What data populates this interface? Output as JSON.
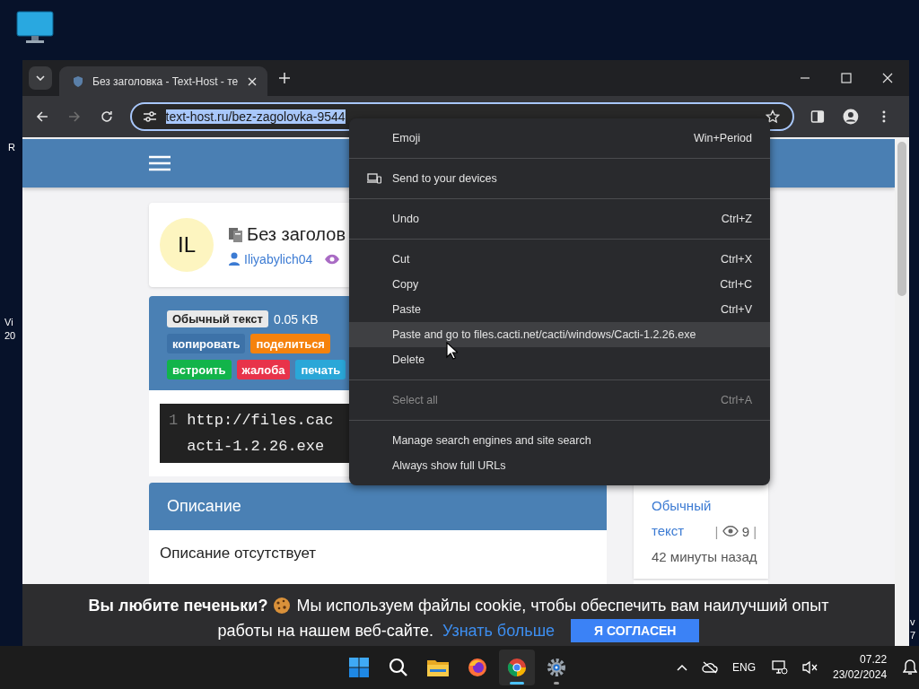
{
  "desktop": {
    "shortcut_labels": [
      {
        "lines": [
          "R"
        ]
      },
      {
        "lines": [
          "Vi",
          "20"
        ]
      },
      {
        "lines": [
          "v",
          "7"
        ]
      }
    ]
  },
  "browser": {
    "tabs": [
      {
        "title": "Без заголовка - Text-Host - те",
        "selected": true
      }
    ],
    "forward_disabled": true,
    "address": {
      "value": "text-host.ru/bez-zagolovka-9544",
      "text_selected": true
    }
  },
  "page": {
    "post": {
      "avatar": "IL",
      "title": "Без заголов",
      "author": "Iliyabylich04"
    },
    "panel": {
      "type_tag": "Обычный текст",
      "size": "0.05 KB",
      "buttons": [
        {
          "label": "копировать",
          "color": "#3d72a8"
        },
        {
          "label": "поделиться",
          "color": "#f5820d"
        },
        {
          "label": "встроить",
          "color": "#12b44a"
        },
        {
          "label": "жалоба",
          "color": "#e8334a"
        },
        {
          "label": "печать",
          "color": "#2aa7d8"
        }
      ]
    },
    "code": {
      "line_number": "1",
      "lines": [
        "http://files.cac",
        "acti-1.2.26.exe"
      ]
    },
    "description": {
      "heading": "Описание",
      "text": "Описание отсутствует"
    },
    "sidebar": {
      "link": "Обычный текст",
      "separator": "|",
      "views": "9",
      "separator_2": "|",
      "time": "42",
      "time_unit": "минуты назад"
    }
  },
  "cookie_banner": {
    "bold": "Вы любите печеньки?",
    "text": "Мы используем файлы cookie, чтобы обеспечить вам наилучший опыт",
    "text_2": "работы на нашем веб-сайте.",
    "link": "Узнать больше",
    "button": "Я СОГЛАСЕН"
  },
  "context_menu": {
    "groups": [
      [
        {
          "label": "Emoji",
          "shortcut": "Win+Period",
          "has_icon": false,
          "disabled": false,
          "selected": false
        }
      ],
      [
        {
          "label": "Send to your devices",
          "has_icon": true,
          "disabled": false,
          "selected": false
        }
      ],
      [
        {
          "label": "Undo",
          "shortcut": "Ctrl+Z",
          "has_icon": false,
          "disabled": false,
          "selected": false
        }
      ],
      [
        {
          "label": "Cut",
          "shortcut": "Ctrl+X",
          "has_icon": false,
          "disabled": false,
          "selected": false
        },
        {
          "label": "Copy",
          "shortcut": "Ctrl+C",
          "has_icon": false,
          "disabled": false,
          "selected": false
        },
        {
          "label": "Paste",
          "shortcut": "Ctrl+V",
          "has_icon": false,
          "disabled": false,
          "selected": false
        },
        {
          "label": "Paste and go to files.cacti.net/cacti/windows/Cacti-1.2.26.exe",
          "has_icon": false,
          "disabled": false,
          "selected": true
        },
        {
          "label": "Delete",
          "has_icon": false,
          "disabled": false,
          "selected": false
        }
      ],
      [
        {
          "label": "Select all",
          "shortcut": "Ctrl+A",
          "has_icon": false,
          "disabled": true,
          "selected": false
        }
      ],
      [
        {
          "label": "Manage search engines and site search",
          "has_icon": false,
          "disabled": false,
          "selected": false
        },
        {
          "label": "Always show full URLs",
          "has_icon": false,
          "disabled": false,
          "selected": false
        }
      ]
    ]
  },
  "taskbar": {
    "apps": [
      {
        "kind": "start",
        "running": false,
        "selected": false
      },
      {
        "kind": "search",
        "running": false,
        "selected": false
      },
      {
        "kind": "files",
        "running": false,
        "selected": false
      },
      {
        "kind": "firefox",
        "running": false,
        "selected": false
      },
      {
        "kind": "chrome",
        "running": true,
        "selected": true
      },
      {
        "kind": "settings",
        "running": true,
        "selected": false
      }
    ],
    "language": "ENG",
    "time": "07.22",
    "date": "23/02/2024"
  }
}
